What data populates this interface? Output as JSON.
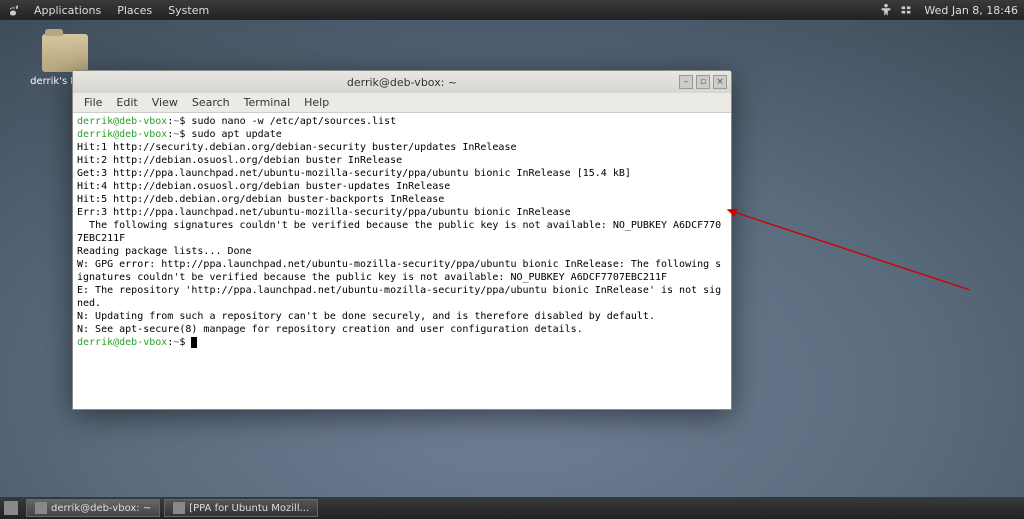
{
  "topbar": {
    "menus": [
      "Applications",
      "Places",
      "System"
    ],
    "clock": "Wed Jan  8, 18:46"
  },
  "desktop_icon": {
    "label": "derrik's Home"
  },
  "terminal": {
    "title": "derrik@deb-vbox: ~",
    "menubar": [
      "File",
      "Edit",
      "View",
      "Search",
      "Terminal",
      "Help"
    ],
    "win_controls": {
      "min": "–",
      "max": "▫",
      "close": "×"
    },
    "prompt": {
      "user": "derrik@deb-vbox",
      "path": "~",
      "sep": ":",
      "sym": "$"
    },
    "lines": [
      {
        "t": "prompt",
        "cmd": "sudo nano -w /etc/apt/sources.list"
      },
      {
        "t": "prompt",
        "cmd": "sudo apt update"
      },
      {
        "t": "out",
        "txt": "Hit:1 http://security.debian.org/debian-security buster/updates InRelease"
      },
      {
        "t": "out",
        "txt": "Hit:2 http://debian.osuosl.org/debian buster InRelease"
      },
      {
        "t": "out",
        "txt": "Get:3 http://ppa.launchpad.net/ubuntu-mozilla-security/ppa/ubuntu bionic InRelease [15.4 kB]"
      },
      {
        "t": "out",
        "txt": "Hit:4 http://debian.osuosl.org/debian buster-updates InRelease"
      },
      {
        "t": "out",
        "txt": "Hit:5 http://deb.debian.org/debian buster-backports InRelease"
      },
      {
        "t": "out",
        "txt": "Err:3 http://ppa.launchpad.net/ubuntu-mozilla-security/ppa/ubuntu bionic InRelease"
      },
      {
        "t": "out",
        "txt": "  The following signatures couldn't be verified because the public key is not available: NO_PUBKEY A6DCF7707EBC211F"
      },
      {
        "t": "out",
        "txt": "Reading package lists... Done"
      },
      {
        "t": "out",
        "txt": "W: GPG error: http://ppa.launchpad.net/ubuntu-mozilla-security/ppa/ubuntu bionic InRelease: The following signatures couldn't be verified because the public key is not available: NO_PUBKEY A6DCF7707EBC211F"
      },
      {
        "t": "out",
        "txt": "E: The repository 'http://ppa.launchpad.net/ubuntu-mozilla-security/ppa/ubuntu bionic InRelease' is not signed."
      },
      {
        "t": "out",
        "txt": "N: Updating from such a repository can't be done securely, and is therefore disabled by default."
      },
      {
        "t": "out",
        "txt": "N: See apt-secure(8) manpage for repository creation and user configuration details."
      },
      {
        "t": "prompt",
        "cmd": ""
      }
    ]
  },
  "bottombar": {
    "tasks": [
      "derrik@deb-vbox: ~",
      "[PPA for Ubuntu Mozill..."
    ]
  }
}
